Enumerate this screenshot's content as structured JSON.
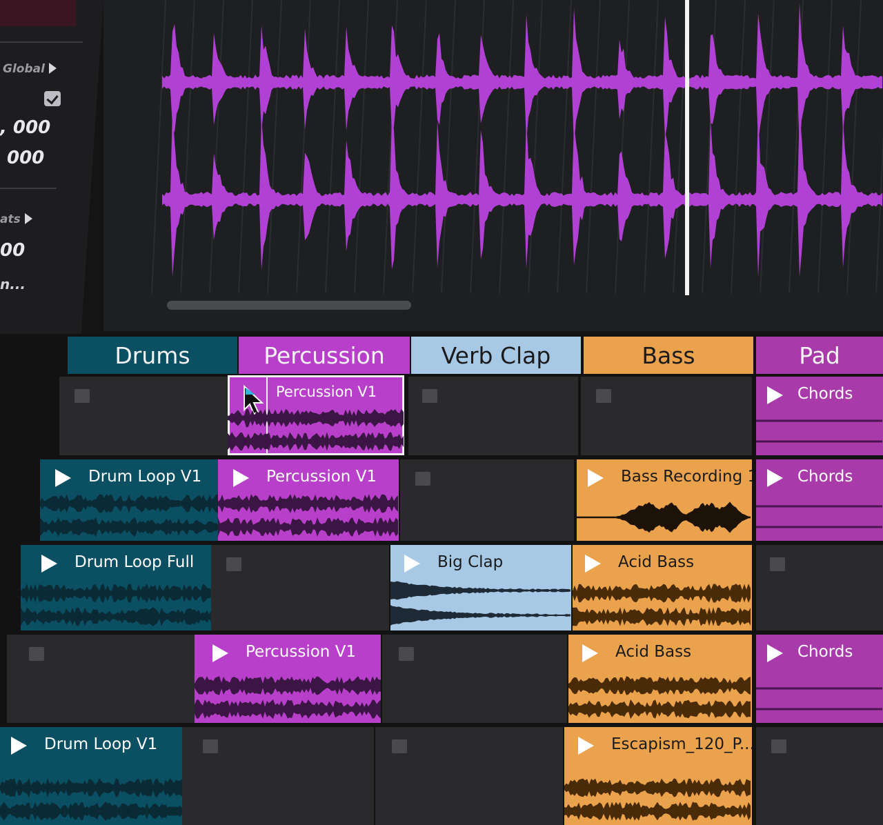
{
  "inspector": {
    "global_label": "Global",
    "value_1": ", 000",
    "value_2": "000",
    "beats_label": "ats",
    "value_3": "00",
    "ellipsis_text": "n..."
  },
  "colors": {
    "drums": "#0a4f62",
    "percussion": "#b73fc9",
    "verb_clap": "#a7c9e6",
    "bass": "#eba24c",
    "pad": "#a83aaa",
    "empty": "#2a2a2c",
    "waveform": "#b140d4"
  },
  "tracks": [
    {
      "name": "Drums"
    },
    {
      "name": "Percussion"
    },
    {
      "name": "Verb Clap"
    },
    {
      "name": "Bass"
    },
    {
      "name": "Pad"
    }
  ],
  "clips": {
    "r0_percussion": "Percussion V1",
    "r0_pad": "Chords",
    "r1_drums": "Drum Loop V1",
    "r1_percussion": "Percussion V1",
    "r1_bass": "Bass Recording 1",
    "r1_pad": "Chords",
    "r2_drums": "Drum Loop Full",
    "r2_verb": "Big Clap",
    "r2_bass": "Acid Bass",
    "r3_percussion": "Percussion V1",
    "r3_bass": "Acid Bass",
    "r3_pad": "Chords",
    "r4_drums": "Drum Loop V1",
    "r4_bass": "Escapism_120_P..."
  }
}
